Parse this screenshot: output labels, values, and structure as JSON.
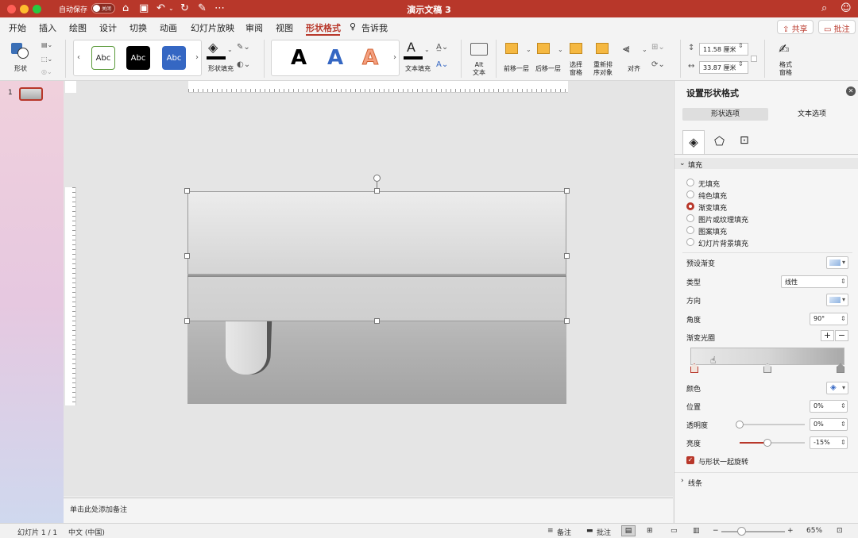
{
  "colors": {
    "accent": "#b8372a",
    "titlebar": "#b8372a"
  },
  "titlebar": {
    "autosave_label": "自动保存",
    "autosave_state": "关闭",
    "doc_title": "演示文稿 3",
    "icons": [
      "home-icon",
      "save-icon",
      "undo-icon",
      "redo-icon",
      "edit-icon"
    ]
  },
  "tabs": [
    "开始",
    "插入",
    "绘图",
    "设计",
    "切换",
    "动画",
    "幻灯片放映",
    "审阅",
    "视图",
    "形状格式"
  ],
  "tell_me": "告诉我",
  "share_label": "共享",
  "comments_label": "批注",
  "ribbon": {
    "shape_label": "形状",
    "style_samples": [
      "Abc",
      "Abc",
      "Abc"
    ],
    "shape_fill_label": "形状填充",
    "wordart_samples": [
      "A",
      "A",
      "A"
    ],
    "text_fill_label": "文本填充",
    "alt_text_label": [
      "Alt",
      "文本"
    ],
    "bring_forward": "前移一层",
    "send_backward": "后移一层",
    "selection_pane": [
      "选择",
      "窗格"
    ],
    "reorder": [
      "重新排",
      "序对象"
    ],
    "align": "对齐",
    "height_value": "11.58 厘米",
    "width_value": "33.87 厘米",
    "format_pane": [
      "格式",
      "窗格"
    ]
  },
  "thumbnails": {
    "number": "1"
  },
  "notes_placeholder": "单击此处添加备注",
  "statusbar": {
    "slide_info": "幻灯片 1 / 1",
    "language": "中文 (中国)",
    "notes": "备注",
    "comments": "批注",
    "zoom": "65%"
  },
  "panel": {
    "title": "设置形状格式",
    "tab_shape": "形状选项",
    "tab_text": "文本选项",
    "fill_section": "填充",
    "fill_options": [
      "无填充",
      "纯色填充",
      "渐变填充",
      "图片或纹理填充",
      "图案填充",
      "幻灯片背景填充"
    ],
    "fill_selected_index": 2,
    "preset_gradient": "预设渐变",
    "type_label": "类型",
    "type_value": "线性",
    "direction_label": "方向",
    "angle_label": "角度",
    "angle_value": "90°",
    "stops_label": "渐变光圈",
    "stop_positions": [
      0,
      0.5,
      1
    ],
    "selected_stop_index": 0,
    "color_label": "颜色",
    "position_label": "位置",
    "position_value": "0%",
    "transparency_label": "透明度",
    "transparency_value": "0%",
    "transparency_level": 0,
    "brightness_label": "亮度",
    "brightness_value": "-15%",
    "brightness_level": 0.43,
    "rotate_with_shape": "与形状一起旋转",
    "line_section": "线条"
  }
}
